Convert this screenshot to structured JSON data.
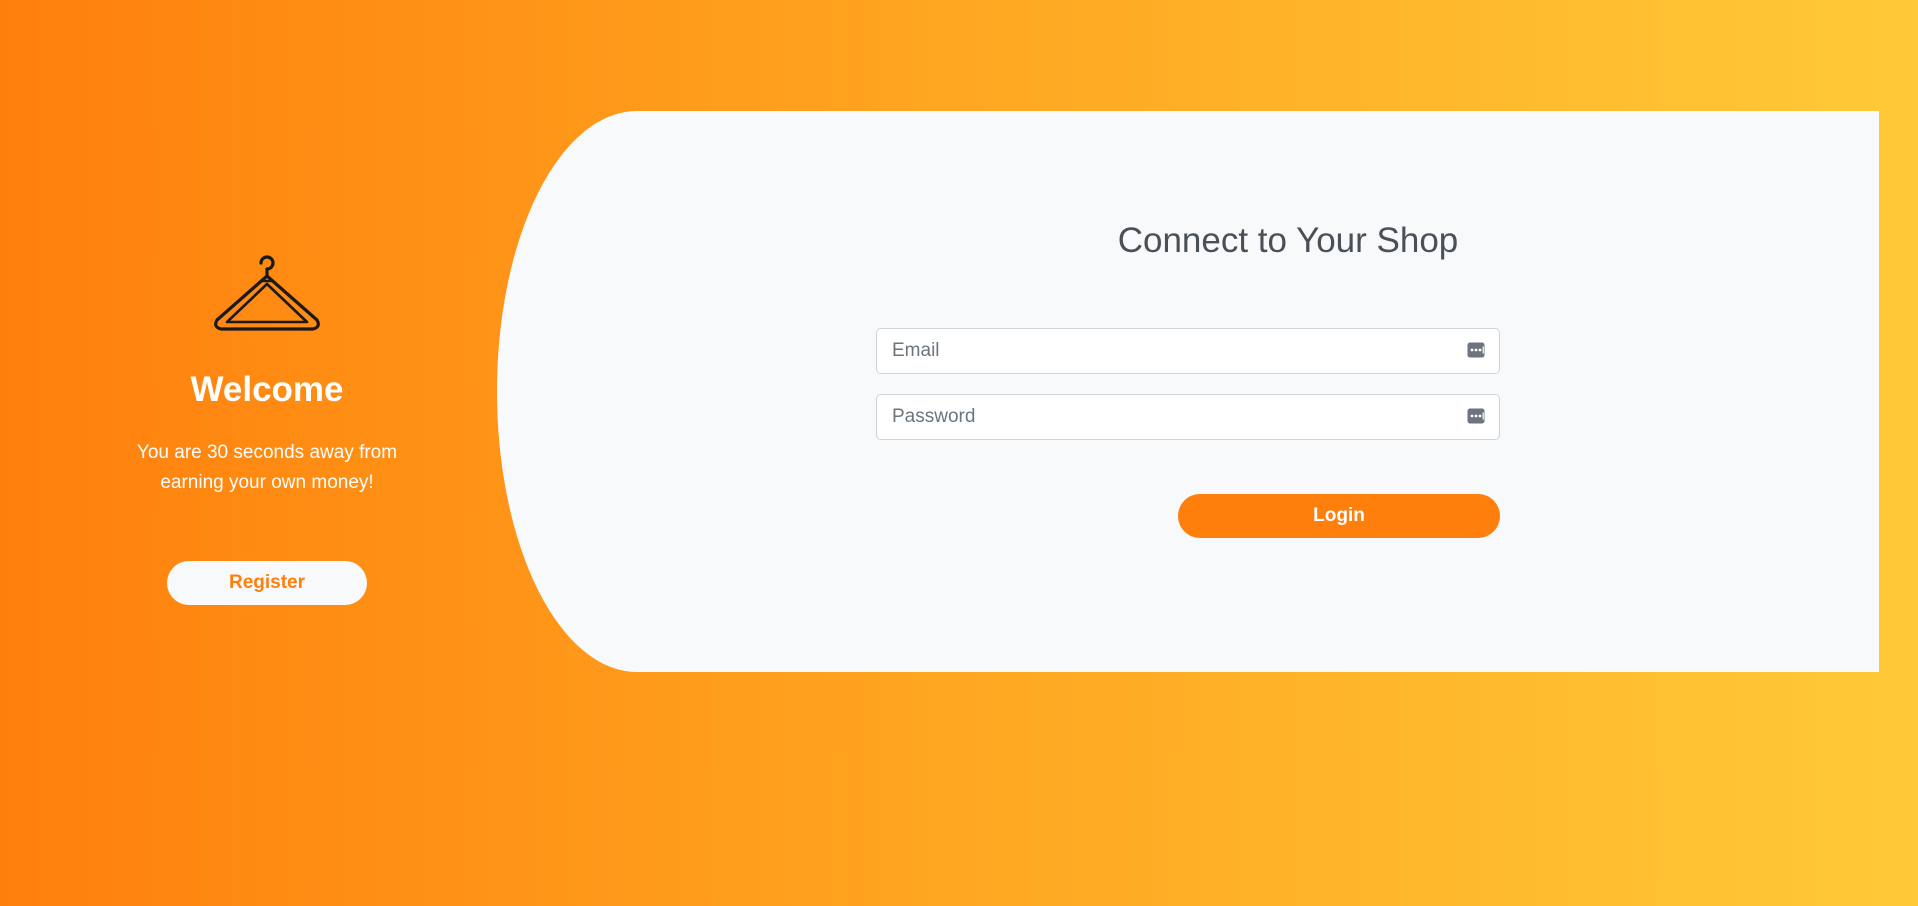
{
  "welcome": {
    "icon": "hanger-icon",
    "title": "Welcome",
    "text": "You are 30 seconds away from earning your own money!",
    "register_label": "Register"
  },
  "login": {
    "title": "Connect to Your Shop",
    "email_placeholder": "Email",
    "email_value": "",
    "password_placeholder": "Password",
    "password_value": "",
    "field_icon": "autofill-key-icon",
    "login_label": "Login"
  },
  "colors": {
    "accent": "#ff7f0d",
    "gradient_start": "#ff7f0d",
    "gradient_end": "#ffc937",
    "card_background": "#f8f9fa",
    "title_text": "#495057"
  }
}
